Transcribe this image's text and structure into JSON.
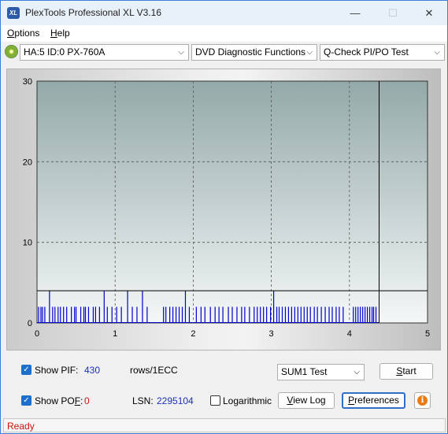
{
  "window": {
    "title": "PlexTools Professional XL V3.16",
    "icon_label": "XL"
  },
  "menu": {
    "options_first": "O",
    "options_rest": "ptions",
    "help_first": "H",
    "help_rest": "elp"
  },
  "toolbar": {
    "drive": "HA:5 ID:0  PX-760A",
    "function": "DVD Diagnostic Functions",
    "test": "Q-Check PI/PO Test"
  },
  "chart_data": {
    "type": "bar",
    "x_ticks": [
      "0",
      "1",
      "2",
      "3",
      "4",
      "5"
    ],
    "y_ticks": [
      "0",
      "10",
      "20",
      "30"
    ],
    "xlim": [
      0,
      5
    ],
    "ylim": [
      0,
      30
    ],
    "grid": true,
    "threshold_y": 4,
    "end_marker_x": 4.38,
    "series": [
      {
        "color": "#0000cc",
        "x": [
          0.02,
          0.05,
          0.07,
          0.1,
          0.16,
          0.2,
          0.23,
          0.27,
          0.3,
          0.34,
          0.38,
          0.44,
          0.48,
          0.5,
          0.56,
          0.6,
          0.62,
          0.66,
          0.72,
          0.75,
          0.8,
          0.86,
          0.9,
          0.96,
          1.02,
          1.08,
          1.16,
          1.22,
          1.28,
          1.35,
          1.41,
          1.62,
          1.65,
          1.7,
          1.74,
          1.78,
          1.82,
          1.86,
          1.9,
          1.95,
          2.04,
          2.1,
          2.15,
          2.22,
          2.28,
          2.33,
          2.38,
          2.45,
          2.5,
          2.56,
          2.62,
          2.66,
          2.72,
          2.78,
          2.82,
          2.86,
          2.9,
          2.94,
          2.99,
          3.03,
          3.07,
          3.1,
          3.14,
          3.18,
          3.22,
          3.26,
          3.3,
          3.34,
          3.38,
          3.42,
          3.46,
          3.5,
          3.55,
          3.59,
          3.64,
          3.69,
          3.74,
          3.78,
          3.83,
          3.87,
          3.92,
          4.05,
          4.08,
          4.11,
          4.14,
          4.17,
          4.2,
          4.23,
          4.26,
          4.29,
          4.31,
          4.34
        ],
        "y": [
          1,
          1,
          1,
          1,
          2,
          1,
          1,
          1,
          1,
          1,
          1,
          1,
          1,
          1,
          1,
          1,
          1,
          1,
          1,
          1,
          1,
          2,
          1,
          1,
          1,
          1,
          2,
          1,
          1,
          2,
          1,
          1,
          1,
          1,
          1,
          1,
          1,
          1,
          2,
          1,
          1,
          1,
          1,
          1,
          1,
          1,
          1,
          1,
          1,
          1,
          1,
          1,
          1,
          1,
          1,
          1,
          1,
          1,
          1,
          2,
          1,
          1,
          1,
          1,
          1,
          1,
          1,
          1,
          1,
          1,
          1,
          1,
          1,
          1,
          1,
          1,
          1,
          1,
          1,
          1,
          1,
          1,
          1,
          1,
          1,
          1,
          1,
          1,
          1,
          1,
          1,
          1
        ]
      }
    ]
  },
  "controls": {
    "show_pif_label": "Show PIF:",
    "pif_value": "430",
    "pif_unit": "rows/1ECC",
    "show_pof_label_a": "Show PO",
    "show_pof_label_b": "F",
    "show_pof_label_c": ":",
    "pof_value": "0",
    "lsn_label": "LSN:",
    "lsn_value": "2295104",
    "logarithmic_label": "Logarithmic",
    "sum_select": "SUM1 Test",
    "start_first": "S",
    "start_rest": "tart",
    "viewlog_first": "V",
    "viewlog_rest": "iew Log",
    "pref_first": "P",
    "pref_rest": "references"
  },
  "status": {
    "text": "Ready"
  },
  "colors": {
    "accent": "#1e6fcc",
    "status_red": "#d01010",
    "value_blue": "#1d2fc0",
    "bar_blue": "#0000cc"
  }
}
